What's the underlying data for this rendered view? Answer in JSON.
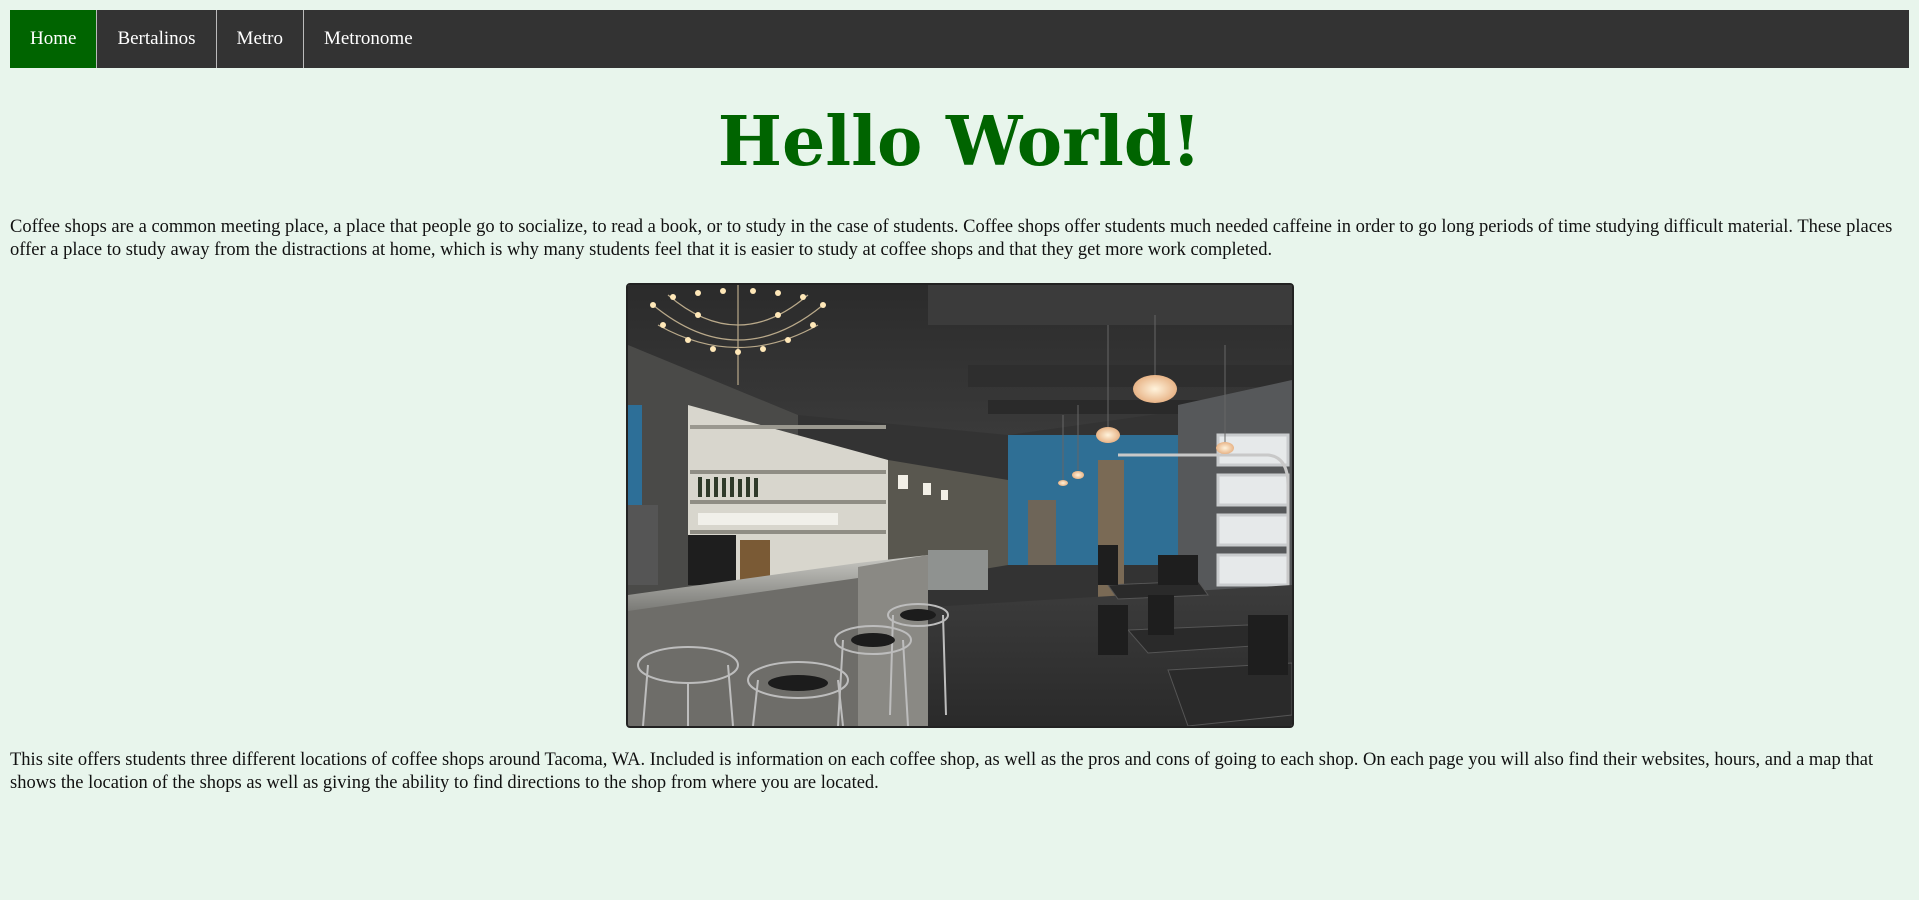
{
  "nav": {
    "items": [
      {
        "label": "Home",
        "active": true
      },
      {
        "label": "Bertalinos",
        "active": false
      },
      {
        "label": "Metro",
        "active": false
      },
      {
        "label": "Metronome",
        "active": false
      }
    ]
  },
  "main": {
    "title": "Hello World!",
    "intro": "Coffee shops are a common meeting place, a place that people go to socialize, to read a book, or to study in the case of students. Coffee shops offer students much needed caffeine in order to go long periods of time studying difficult material. These places offer a place to study away from the distractions at home, which is why many students feel that it is easier to study at coffee shops and that they get more work completed.",
    "outro": "This site offers students three different locations of coffee shops around Tacoma, WA. Included is information on each coffee shop, as well as the pros and cons of going to each shop. On each page you will also find their websites, hours, and a map that shows the location of the shops as well as giving the ability to find directions to the shop from where you are located."
  },
  "colors": {
    "page_background": "#e8f5ec",
    "nav_background": "#333333",
    "accent_green": "#006400"
  }
}
